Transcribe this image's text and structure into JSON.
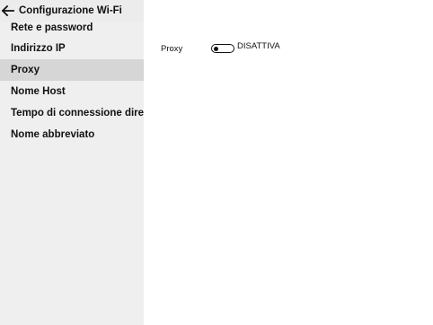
{
  "header": {
    "icon": "arrow-left-icon",
    "title": "Configurazione Wi-Fi"
  },
  "sidebar": {
    "items": [
      {
        "label": "Rete e password",
        "selected": false
      },
      {
        "label": "Indirizzo IP",
        "selected": false
      },
      {
        "label": "Proxy",
        "selected": true
      },
      {
        "label": "Nome Host",
        "selected": false
      },
      {
        "label": "Tempo di connessione diretta",
        "selected": false
      },
      {
        "label": "Nome abbreviato",
        "selected": false
      }
    ]
  },
  "main": {
    "proxy": {
      "label": "Proxy",
      "toggle_state": "DISATTIVA",
      "enabled": false
    }
  },
  "colors": {
    "sidebar_bg": "#efefef",
    "selected_bg": "#d6d6d6",
    "text": "#111111"
  }
}
